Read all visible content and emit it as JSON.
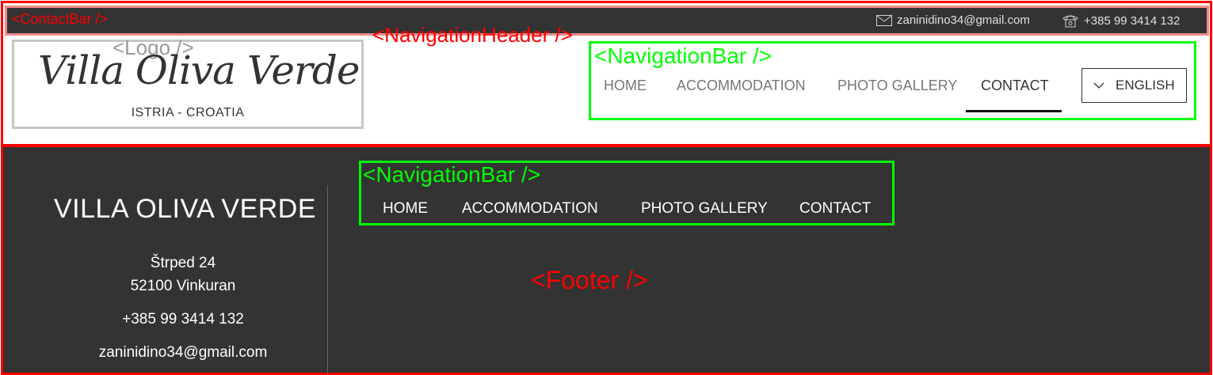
{
  "annotations": {
    "contact_bar": "<ContactBar />",
    "navigation_header": "<NavigationHeader />",
    "logo": "<Logo />",
    "navigation_bar": "<NavigationBar />",
    "footer": "<Footer />"
  },
  "contact": {
    "email": "zaninidino34@gmail.com",
    "phone": "+385 99 3414 132",
    "email_icon": "envelope-icon",
    "phone_icon": "telephone-icon"
  },
  "logo": {
    "script": "Villa Oliva Verde",
    "subtitle": "ISTRIA - CROATIA"
  },
  "header_nav": {
    "items": [
      {
        "label": "HOME"
      },
      {
        "label": "ACCOMMODATION"
      },
      {
        "label": "PHOTO GALLERY"
      },
      {
        "label": "CONTACT",
        "active": true
      }
    ],
    "language": "ENGLISH"
  },
  "footer": {
    "title": "VILLA OLIVA VERDE",
    "address_line1": "Štrped 24",
    "address_line2": "52100 Vinkuran",
    "phone": "+385 99 3414 132",
    "email": "zaninidino34@gmail.com",
    "nav": [
      {
        "label": "HOME"
      },
      {
        "label": "ACCOMMODATION"
      },
      {
        "label": "PHOTO GALLERY"
      },
      {
        "label": "CONTACT"
      }
    ]
  },
  "colors": {
    "dark_bg": "#333333",
    "annotation_red": "#ff0000",
    "annotation_green": "#00ff00"
  }
}
